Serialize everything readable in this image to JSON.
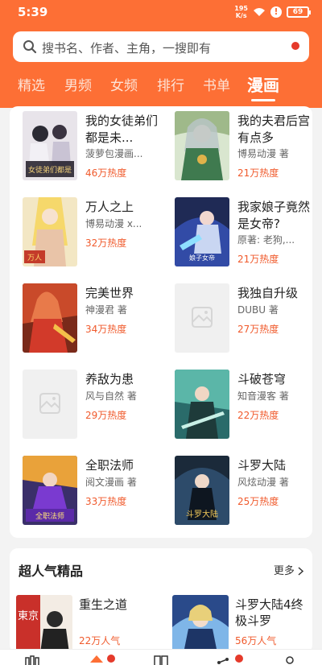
{
  "status": {
    "time": "5:39",
    "speed_value": "195",
    "speed_unit": "K/s",
    "battery": "69"
  },
  "search": {
    "placeholder": "搜书名、作者、主角，一搜即有"
  },
  "tabs": [
    {
      "label": "精选",
      "active": false
    },
    {
      "label": "男频",
      "active": false
    },
    {
      "label": "女频",
      "active": false
    },
    {
      "label": "排行",
      "active": false
    },
    {
      "label": "书单",
      "active": false
    },
    {
      "label": "漫画",
      "active": true
    }
  ],
  "books": [
    {
      "title": "我的女徒弟们都是未...",
      "meta": "菠萝包漫画...",
      "heat": "46万热度"
    },
    {
      "title": "我的夫君后宫有点多",
      "meta": "博易动漫 著",
      "heat": "21万热度"
    },
    {
      "title": "万人之上",
      "meta": "博易动漫 x...",
      "heat": "32万热度"
    },
    {
      "title": "我家娘子竟然是女帝?",
      "meta": "原著: 老狗,...",
      "heat": "21万热度"
    },
    {
      "title": "完美世界",
      "meta": "神漫君 著",
      "heat": "34万热度"
    },
    {
      "title": "我独自升级",
      "meta": "DUBU 著",
      "heat": "27万热度"
    },
    {
      "title": "养敌为患",
      "meta": "风与自然 著",
      "heat": "29万热度"
    },
    {
      "title": "斗破苍穹",
      "meta": "知音漫客 著",
      "heat": "22万热度"
    },
    {
      "title": "全职法师",
      "meta": "阅文漫画 著",
      "heat": "33万热度"
    },
    {
      "title": "斗罗大陆",
      "meta": "风炫动漫 著",
      "heat": "25万热度"
    }
  ],
  "cover_texts": {
    "b0": "女徒弟们都是",
    "b2": "万人",
    "b3": "娘子女帝",
    "b8": "全职法师",
    "b9": "斗罗大陆"
  },
  "section": {
    "title": "超人气精品",
    "more": "更多"
  },
  "recommend": [
    {
      "title": "重生之道",
      "heat": "22万人气"
    },
    {
      "title": "斗罗大陆4终极斗罗",
      "heat": "56万人气"
    }
  ],
  "rec_cover_text": "東京",
  "colors": {
    "accent": "#fd6f35",
    "heat": "#f05a2c",
    "badge": "#e53a2b"
  },
  "icons": [
    "search-icon",
    "wifi-icon",
    "alert-icon",
    "placeholder-image-icon",
    "chevron-right-icon",
    "bookshelf-icon",
    "home-icon",
    "category-icon",
    "community-icon",
    "profile-icon"
  ]
}
